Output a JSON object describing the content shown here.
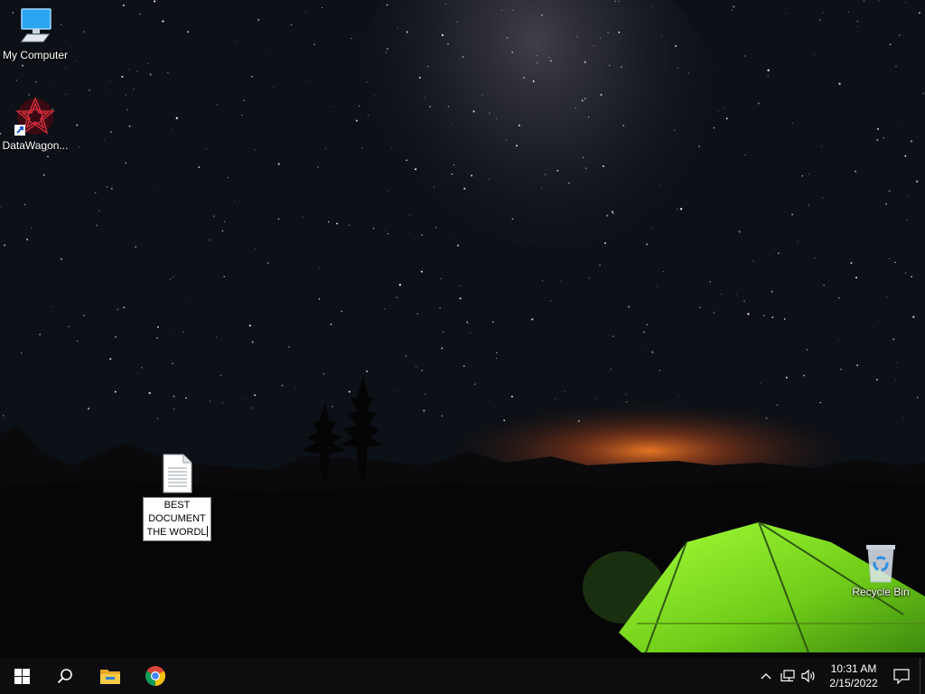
{
  "desktop": {
    "icons": [
      {
        "id": "my-computer",
        "label": "My Computer",
        "icon": "computer-icon"
      },
      {
        "id": "datawagon",
        "label": "DataWagon...",
        "icon": "datawagon-app-icon",
        "shortcut": true
      },
      {
        "id": "recycle-bin",
        "label": "Recycle Bin",
        "icon": "recycle-bin-icon"
      }
    ],
    "document": {
      "icon": "text-document-icon",
      "rename_lines": [
        "BEST",
        "DOCUMENT",
        "THE WORDL"
      ]
    }
  },
  "taskbar": {
    "start": "windows-start-icon",
    "search": "search-icon",
    "pinned": [
      "file-explorer-icon",
      "chrome-icon"
    ],
    "tray": {
      "overflow": "chevron-up-icon",
      "network": "network-icon",
      "volume": "volume-icon",
      "time": "10:31 AM",
      "date": "2/15/2022",
      "notifications": "notification-icon"
    }
  },
  "colors": {
    "taskbar_bg": "#0d0d0f",
    "tent": "#7bd61a",
    "horizon_glow": "#e0621c"
  }
}
